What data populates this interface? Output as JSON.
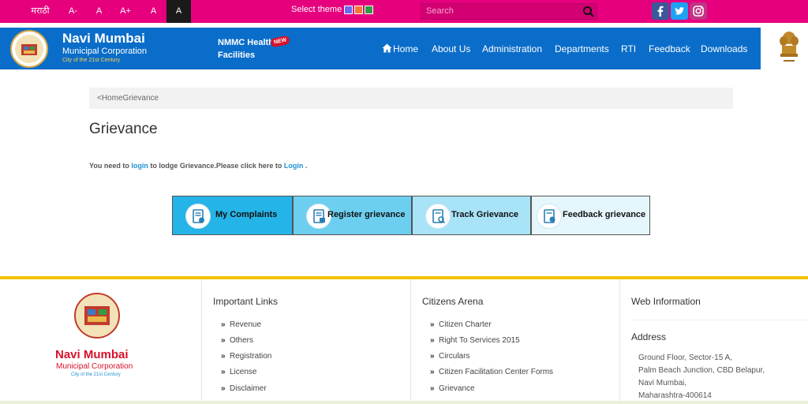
{
  "topbar": {
    "lang": "मराठी",
    "font_small": "A-",
    "font_normal": "A",
    "font_large": "A+",
    "contrast_a": "A",
    "contrast_b": "A",
    "theme_label": "Select theme :",
    "theme_colors": [
      "#6a6cf0",
      "#f07a34",
      "#2e9e45"
    ],
    "search_placeholder": "Search",
    "social_colors": {
      "facebook": "#3b5998",
      "twitter": "#1da1f2",
      "instagram": "#c13584"
    }
  },
  "header": {
    "brand_title": "Navi Mumbai",
    "brand_sub": "Municipal Corporation",
    "brand_tag": "City of the 21st Century",
    "health_link": "NMMC Health Facilities",
    "new_badge": "NEW",
    "nav": [
      "Home",
      "About Us",
      "Administration",
      "Departments",
      "RTI",
      "Feedback",
      "Downloads"
    ]
  },
  "breadcrumb": "<HomeGrievance",
  "page_title": "Grievance",
  "message": {
    "part1": "You need to ",
    "link1": "login",
    "part2": " to lodge Grievance.Please click here to ",
    "link2": "Login",
    "part3": " ."
  },
  "grievance_buttons": [
    {
      "label": "My Complaints",
      "bg": "#25b4e7"
    },
    {
      "label": "Register grievance",
      "bg": "#6ccff0"
    },
    {
      "label": "Track Grievance",
      "bg": "#a8e3f7"
    },
    {
      "label": "Feedback grievance",
      "bg": "#e6f6fd"
    }
  ],
  "footer": {
    "brand_title": "Navi Mumbai",
    "brand_sub": "Municipal Corporation",
    "brand_tag": "City of the 21st Century",
    "important_links_title": "Important Links",
    "important_links": [
      "Revenue",
      "Others",
      "Registration",
      "License",
      "Disclaimer"
    ],
    "citizens_title": "Citizens Arena",
    "citizens_links": [
      "Citizen Charter",
      "Right To Services 2015",
      "Circulars",
      "Citizen Facilitation Center Forms",
      "Grievance"
    ],
    "web_info_title": "Web Information",
    "address_title": "Address",
    "address_lines": [
      "Ground Floor, Sector-15 A,",
      "Palm Beach Junction, CBD Belapur,",
      "Navi Mumbai,",
      "Maharashtra-400614"
    ]
  }
}
